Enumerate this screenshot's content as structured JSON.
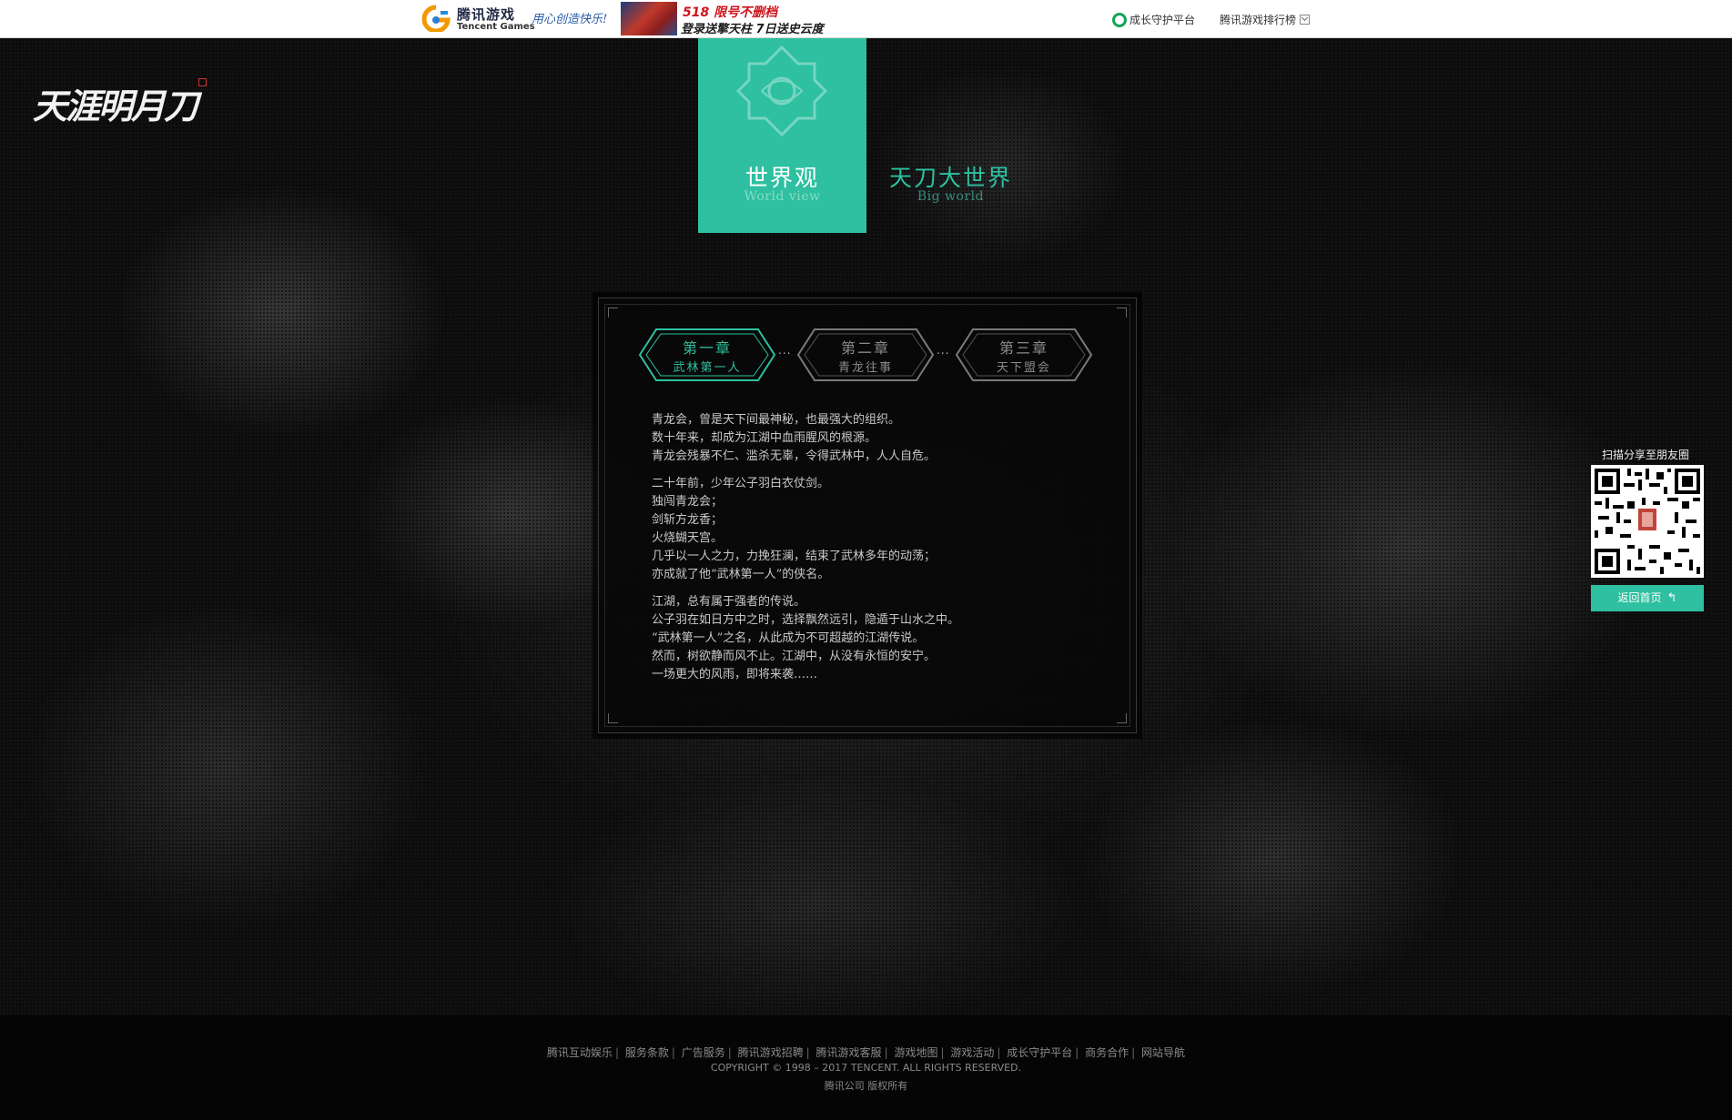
{
  "topbar": {
    "tencent_logo_cn": "腾讯游戏",
    "tencent_logo_en": "Tencent Games",
    "slogan": "用心创造快乐!",
    "promo_line1": "518 限号不删档",
    "promo_line2": "登录送擎天柱 7日送史云度",
    "guard_label": "成长守护平台",
    "rank_label": "腾讯游戏排行榜"
  },
  "game_logo": "天涯明月刀",
  "nav": {
    "world": {
      "title": "世界观",
      "subtitle": "World view"
    },
    "big": {
      "title": "天刀大世界",
      "subtitle": "Big world"
    }
  },
  "chapters": [
    {
      "title": "第一章",
      "subtitle": "武林第一人",
      "active": true
    },
    {
      "title": "第二章",
      "subtitle": "青龙往事",
      "active": false
    },
    {
      "title": "第三章",
      "subtitle": "天下盟会",
      "active": false
    }
  ],
  "chapter_separator": "...",
  "story": {
    "p1": [
      "青龙会，曾是天下间最神秘，也最强大的组织。",
      "数十年来，却成为江湖中血雨腥风的根源。",
      "青龙会残暴不仁、滥杀无辜，令得武林中，人人自危。"
    ],
    "p2": [
      "二十年前，少年公子羽白衣仗剑。",
      "独闯青龙会；",
      "剑斩方龙香；",
      "火烧蝴天宫。",
      "几乎以一人之力，力挽狂澜，结束了武林多年的动荡；",
      "亦成就了他“武林第一人”的侠名。"
    ],
    "p3": [
      "江湖，总有属于强者的传说。",
      "公子羽在如日方中之时，选择飘然远引，隐遁于山水之中。",
      "“武林第一人”之名，从此成为不可超越的江湖传说。",
      "然而，树欲静而风不止。江湖中，从没有永恒的安宁。",
      "一场更大的风雨，即将来袭……"
    ]
  },
  "side": {
    "qr_label": "扫描分享至朋友圈",
    "back_home": "返回首页",
    "back_arrow": "↰"
  },
  "footer": {
    "links": [
      "腾讯互动娱乐",
      "服务条款",
      "广告服务",
      "腾讯游戏招聘",
      "腾讯游戏客服",
      "游戏地图",
      "游戏活动",
      "成长守护平台",
      "商务合作",
      "网站导航"
    ],
    "separator": "|",
    "copyright": "COPYRIGHT © 1998 – 2017 TENCENT. ALL RIGHTS RESERVED.",
    "corp": "腾讯公司 版权所有"
  },
  "colors": {
    "accent": "#2ec0a0",
    "topbar_bg": "#ffffff",
    "page_bg": "#101010"
  }
}
